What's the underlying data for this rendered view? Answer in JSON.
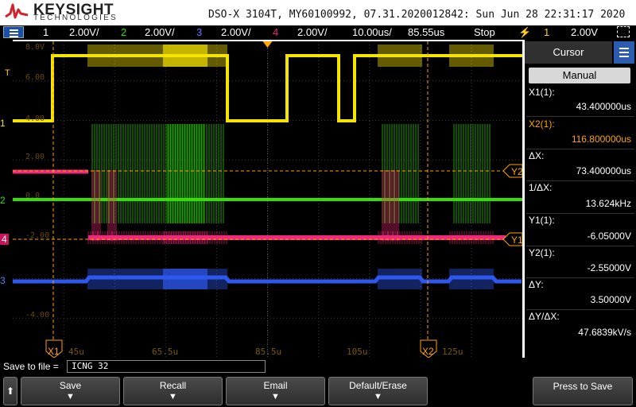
{
  "header": {
    "brand": "KEYSIGHT",
    "tagline": "TECHNOLOGIES",
    "scope_id": "DSO-X 3104T, MY60100992, 07.31.2020012842: Sun Jun 28 22:31:17 2020"
  },
  "channel_bar": {
    "ch1": {
      "num": "1",
      "scale": "2.00V/"
    },
    "ch2": {
      "num": "2",
      "scale": "2.00V/"
    },
    "ch3": {
      "num": "3",
      "scale": "2.00V/"
    },
    "ch4": {
      "num": "4",
      "scale": "2.00V/"
    },
    "timebase": "10.00us/",
    "delay": "85.55us",
    "run_state": "Stop",
    "trigger_channel": "1",
    "trigger_level": "2.00V"
  },
  "colors": {
    "ch1": "#f5e400",
    "ch2": "#35e000",
    "ch3": "#2d58f0",
    "ch4": "#f0287a",
    "cursor": "#ffa500",
    "menu_blue": "#2a5cb0"
  },
  "plot": {
    "time_labels": [
      "45u",
      "65.5u",
      "85.5u",
      "105u",
      "125u"
    ],
    "voltage_labels": [
      "8.0V",
      "6.00",
      "4.00",
      "2.00",
      "0.0",
      "-2.00",
      "-4.00"
    ],
    "cursor_markers": {
      "x1": "X1",
      "x2": "X2",
      "y1": "Y1",
      "y2": "Y2"
    },
    "channel_markers": [
      "1",
      "2",
      "3",
      "4"
    ],
    "trigger_marker": "T"
  },
  "cursor_panel": {
    "title": "Cursor",
    "mode": "Manual",
    "rows": [
      {
        "label": "X1(1):",
        "value": "43.400000us"
      },
      {
        "label": "X2(1):",
        "value": "116.800000us"
      },
      {
        "label": "ΔX:",
        "value": "73.400000us"
      },
      {
        "label": "1/ΔX:",
        "value": "13.624kHz"
      },
      {
        "label": "Y1(1):",
        "value": "-6.05000V"
      },
      {
        "label": "Y2(1):",
        "value": "-2.55000V"
      },
      {
        "label": "ΔY:",
        "value": "3.50000V"
      },
      {
        "label": "ΔY/ΔX:",
        "value": "47.6839kV/s"
      }
    ]
  },
  "save_bar": {
    "label": "Save to file =",
    "filename": "ICNG 32"
  },
  "softkeys": [
    {
      "label": "Save"
    },
    {
      "label": "Recall"
    },
    {
      "label": "Email"
    },
    {
      "label": "Default/Erase"
    },
    {
      "label": "Press to Save"
    }
  ]
}
